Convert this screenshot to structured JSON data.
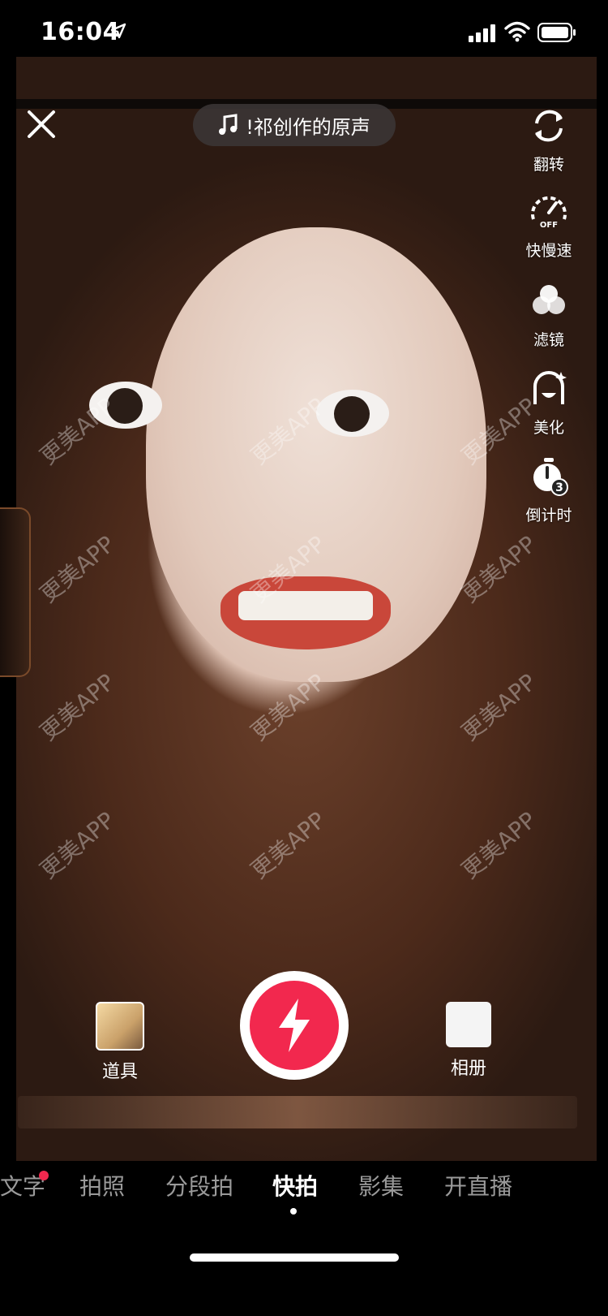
{
  "status": {
    "time": "16:04"
  },
  "top": {
    "music_label": "!祁创作的原声"
  },
  "tools": [
    {
      "label": "翻转",
      "icon": "flip-camera-icon"
    },
    {
      "label": "快慢速",
      "icon": "speed-icon",
      "icon_text": "OFF"
    },
    {
      "label": "滤镜",
      "icon": "filter-icon"
    },
    {
      "label": "美化",
      "icon": "beauty-icon"
    },
    {
      "label": "倒计时",
      "icon": "timer-icon",
      "icon_text": "3"
    }
  ],
  "bottom": {
    "props_label": "道具",
    "album_label": "相册"
  },
  "watermark": "更美APP",
  "modes": [
    "文字",
    "拍照",
    "分段拍",
    "快拍",
    "影集",
    "开直播"
  ],
  "active_mode": "快拍",
  "colors": {
    "accent": "#f2284e"
  }
}
